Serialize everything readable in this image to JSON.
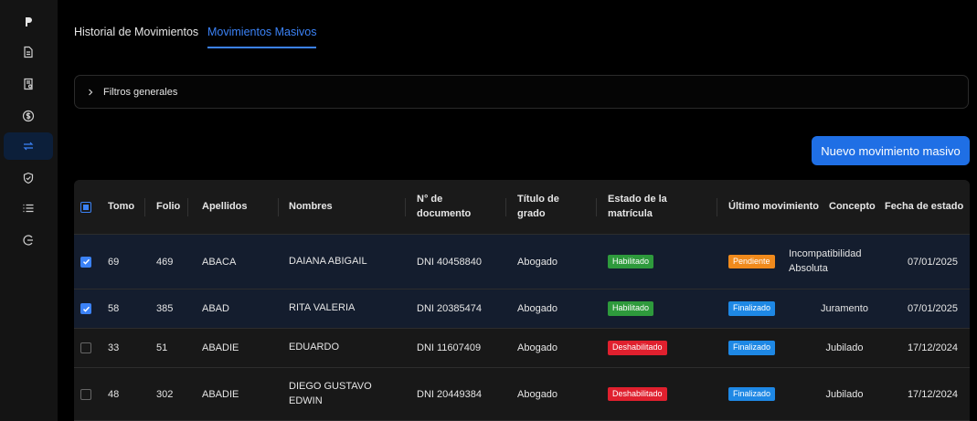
{
  "tabs": [
    {
      "label": "Historial de Movimientos",
      "active": false
    },
    {
      "label": "Movimientos Masivos",
      "active": true
    }
  ],
  "filters": {
    "label": "Filtros generales"
  },
  "actions": {
    "new_label": "Nuevo movimiento masivo"
  },
  "sidebar": {
    "icons": [
      "logo-icon",
      "document-icon",
      "certificate-icon",
      "dollar-icon",
      "transfer-icon",
      "shield-check-icon",
      "list-icon",
      "logout-icon"
    ],
    "active_index": 4
  },
  "colors": {
    "accent": "#1f6fe5",
    "habilitado": "#2e9a3c",
    "deshabilitado": "#e0202e",
    "pendiente": "#f08a1c",
    "finalizado": "#1e88e5"
  },
  "table": {
    "headers": {
      "tomo": "Tomo",
      "folio": "Folio",
      "apellidos": "Apellidos",
      "nombres": "Nombres",
      "documento_1": "N° de",
      "documento_2": "documento",
      "titulo_1": "Título de",
      "titulo_2": "grado",
      "estado_1": "Estado de la",
      "estado_2": "matrícula",
      "ultimo": "Último movimiento",
      "concepto": "Concepto",
      "fecha": "Fecha de estado"
    },
    "rows": [
      {
        "checked": true,
        "tomo": "69",
        "folio": "469",
        "apellidos": "ABACA",
        "nombres_1": "DAIANA ABIGAIL",
        "nombres_2": "",
        "documento": "DNI 40458840",
        "titulo": "Abogado",
        "estado": "Habilitado",
        "estado_kind": "habilitado",
        "ultimo": "Pendiente",
        "ultimo_kind": "pendiente",
        "concepto_1": "Incompatibilidad",
        "concepto_2": "Absoluta",
        "fecha": "07/01/2025"
      },
      {
        "checked": true,
        "tomo": "58",
        "folio": "385",
        "apellidos": "ABAD",
        "nombres_1": "RITA VALERIA",
        "nombres_2": "",
        "documento": "DNI 20385474",
        "titulo": "Abogado",
        "estado": "Habilitado",
        "estado_kind": "habilitado",
        "ultimo": "Finalizado",
        "ultimo_kind": "finalizado",
        "concepto_1": "Juramento",
        "concepto_2": "",
        "fecha": "07/01/2025"
      },
      {
        "checked": false,
        "tomo": "33",
        "folio": "51",
        "apellidos": "ABADIE",
        "nombres_1": "EDUARDO",
        "nombres_2": "",
        "documento": "DNI 11607409",
        "titulo": "Abogado",
        "estado": "Deshabilitado",
        "estado_kind": "deshabilitado",
        "ultimo": "Finalizado",
        "ultimo_kind": "finalizado",
        "concepto_1": "Jubilado",
        "concepto_2": "",
        "fecha": "17/12/2024"
      },
      {
        "checked": false,
        "tomo": "48",
        "folio": "302",
        "apellidos": "ABADIE",
        "nombres_1": "DIEGO GUSTAVO",
        "nombres_2": "EDWIN",
        "documento": "DNI 20449384",
        "titulo": "Abogado",
        "estado": "Deshabilitado",
        "estado_kind": "deshabilitado",
        "ultimo": "Finalizado",
        "ultimo_kind": "finalizado",
        "concepto_1": "Jubilado",
        "concepto_2": "",
        "fecha": "17/12/2024"
      }
    ]
  }
}
